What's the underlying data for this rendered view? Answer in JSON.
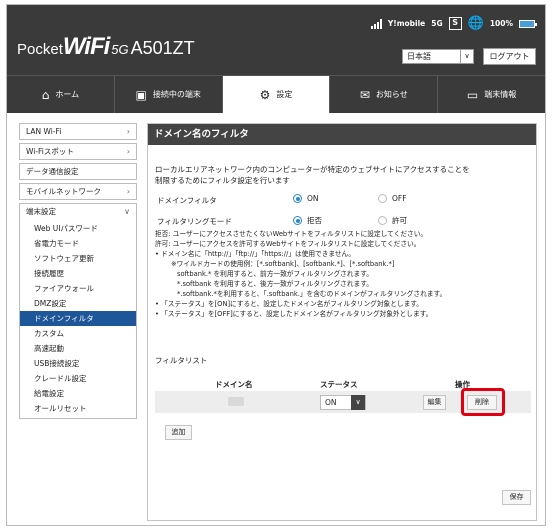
{
  "brand": {
    "part1": "Pocket",
    "part2": "WiFi",
    "part3": "5G",
    "model": "A501ZT"
  },
  "status": {
    "carrier": "Y!mobile",
    "network": "5G",
    "sim": "S",
    "battery": "100%"
  },
  "language": {
    "selected": "日本語"
  },
  "logout_label": "ログアウト",
  "nav": {
    "tabs": [
      {
        "label": "ホーム"
      },
      {
        "label": "接続中の端末"
      },
      {
        "label": "設定"
      },
      {
        "label": "お知らせ"
      },
      {
        "label": "端末情報"
      }
    ]
  },
  "sidebar": {
    "items": [
      "LAN Wi-Fi",
      "Wi-Fiスポット",
      "データ通信設定",
      "モバイルネットワーク"
    ],
    "group": {
      "label": "端末設定",
      "subitems": [
        "Web UIパスワード",
        "省電力モード",
        "ソフトウェア更新",
        "接続履歴",
        "ファイアウォール",
        "DMZ設定",
        "ドメインフィルタ",
        "カスタム",
        "高速起動",
        "USB接続設定",
        "クレードル設定",
        "給電設定",
        "オールリセット"
      ]
    }
  },
  "main": {
    "title": "ドメイン名のフィルタ",
    "desc1": "ローカルエリアネットワーク内のコンピューターが特定のウェブサイトにアクセスすることを",
    "desc2": "制限するためにフィルタ設定を行います",
    "domain_filter": {
      "label": "ドメインフィルタ",
      "on": "ON",
      "off": "OFF"
    },
    "filtering_mode": {
      "label": "フィルタリングモード",
      "deny": "拒否",
      "allow": "許可"
    },
    "notes": [
      "拒否: ユーザーにアクセスさせたくないWebサイトをフィルタリストに設定してください。",
      "許可: ユーザーにアクセスを許可するWebサイトをフィルタリストに設定してください。",
      "• ドメイン名に「http://」「ftp://」「https://」は使用できません。",
      "※ワイルドカードの使用例：[*.softbank]、[softbank.*]、[*.softbank.*]",
      "softbank.* を利用すると、前方一致がフィルタリングされます。",
      "*.softbank を利用すると、後方一致がフィルタリングされます。",
      "*.softbank.*を利用すると、「.softbank.」を含むのドメインがフィルタリングされます。",
      "• 「ステータス」を[ON]にすると、設定したドメイン名がフィルタリング対象とします。",
      "• 「ステータス」を[OFF]にすると、設定したドメイン名がフィルタリング対象外とします。"
    ],
    "filter_list_label": "フィルタリスト",
    "table": {
      "col_domain": "ドメイン名",
      "col_status": "ステータス",
      "col_action": "操作"
    },
    "row": {
      "status": "ON",
      "edit": "編集",
      "delete": "削除"
    },
    "add_label": "追加",
    "save_label": "保存"
  }
}
